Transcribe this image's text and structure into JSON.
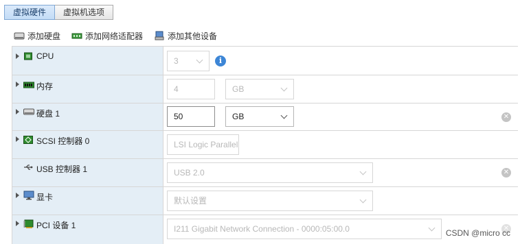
{
  "tabs": [
    {
      "label": "虚拟硬件",
      "active": true
    },
    {
      "label": "虚拟机选项",
      "active": false
    }
  ],
  "toolbar": {
    "add_disk": "添加硬盘",
    "add_nic": "添加网络适配器",
    "add_other": "添加其他设备"
  },
  "devices": {
    "cpu": {
      "label": "CPU",
      "value": "3"
    },
    "memory": {
      "label": "内存",
      "value": "4",
      "unit": "GB"
    },
    "disk": {
      "label": "硬盘 1",
      "value": "50",
      "unit": "GB"
    },
    "scsi": {
      "label": "SCSI 控制器 0",
      "value": "LSI Logic Parallel"
    },
    "usb": {
      "label": "USB 控制器 1",
      "value": "USB 2.0"
    },
    "video": {
      "label": "显卡",
      "value": "默认设置"
    },
    "pci": {
      "label": "PCI 设备 1",
      "value": "I211 Gigabit Network Connection - 0000:05:00.0"
    }
  },
  "watermark": "CSDN @micro cc",
  "colors": {
    "left_panel": "#e4eef6",
    "active_tab": "#c3dcf6",
    "info": "#3d86d6"
  }
}
